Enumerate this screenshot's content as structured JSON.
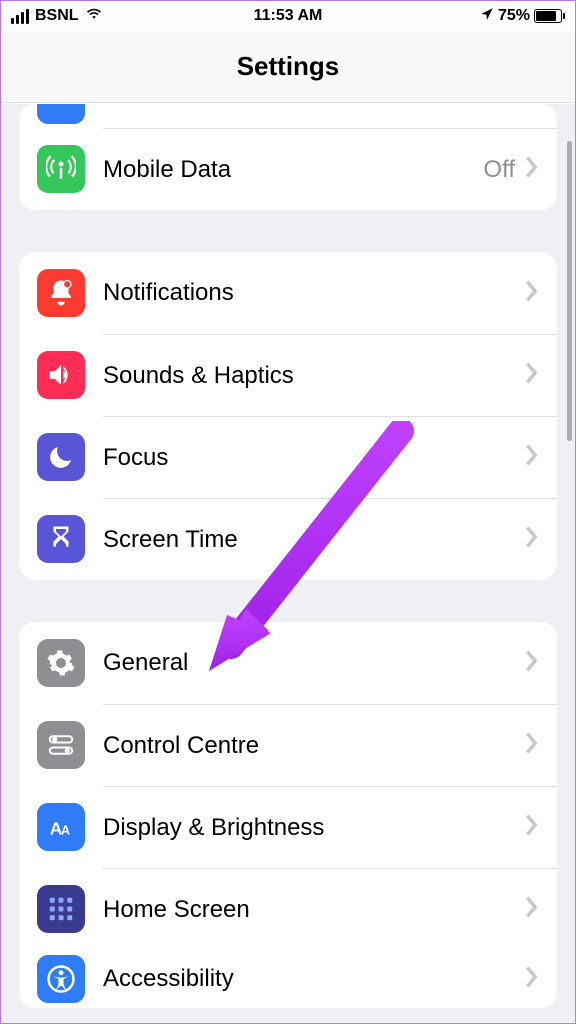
{
  "statusbar": {
    "carrier": "BSNL",
    "time": "11:53 AM",
    "battery_pct": "75%"
  },
  "header": {
    "title": "Settings"
  },
  "groups": [
    {
      "rows": [
        {
          "icon": "bluetooth-partial",
          "label": "",
          "value": ""
        },
        {
          "icon": "antenna",
          "label": "Mobile Data",
          "value": "Off"
        }
      ]
    },
    {
      "rows": [
        {
          "icon": "bell",
          "label": "Notifications",
          "value": ""
        },
        {
          "icon": "speaker",
          "label": "Sounds & Haptics",
          "value": ""
        },
        {
          "icon": "moon",
          "label": "Focus",
          "value": ""
        },
        {
          "icon": "hourglass",
          "label": "Screen Time",
          "value": ""
        }
      ]
    },
    {
      "rows": [
        {
          "icon": "gear",
          "label": "General",
          "value": ""
        },
        {
          "icon": "switches",
          "label": "Control Centre",
          "value": ""
        },
        {
          "icon": "textsize",
          "label": "Display & Brightness",
          "value": ""
        },
        {
          "icon": "grid",
          "label": "Home Screen",
          "value": ""
        },
        {
          "icon": "accessibility",
          "label": "Accessibility",
          "value": ""
        }
      ]
    }
  ],
  "annotation": {
    "arrow_color": "#b030ff"
  }
}
